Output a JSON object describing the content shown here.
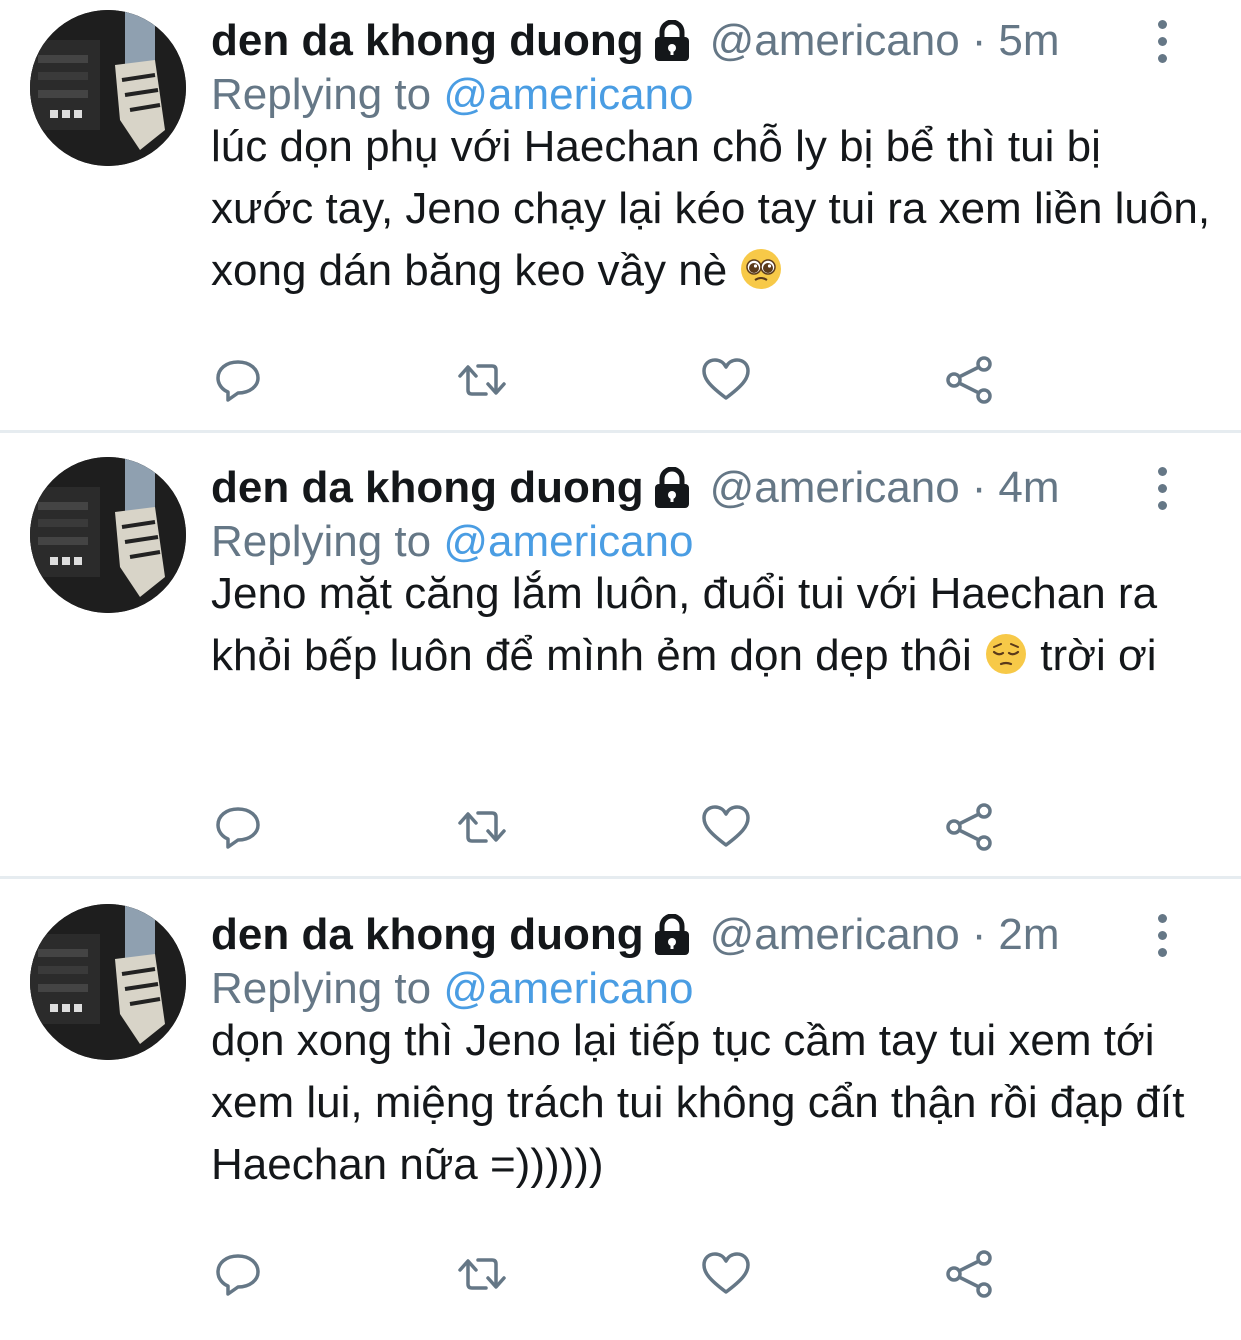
{
  "tweets": [
    {
      "name": "den da khong duong",
      "handle": "@americano",
      "separator": "·",
      "time": "5m",
      "replying_prefix": "Replying to",
      "replying_handle": "@americano",
      "text_before_emoji": "lúc dọn phụ với Haechan chỗ ly bị bể thì tui bị xước tay, Jeno chạy lại kéo tay tui ra xem liền luôn, xong dán băng keo vầy nè ",
      "emoji": "pleading-face",
      "text_after_emoji": ""
    },
    {
      "name": "den da khong duong",
      "handle": "@americano",
      "separator": "·",
      "time": "4m",
      "replying_prefix": "Replying to",
      "replying_handle": "@americano",
      "text_before_emoji": "Jeno mặt căng lắm luôn, đuổi tui với Haechan ra khỏi bếp luôn để mình ẻm dọn dẹp thôi ",
      "emoji": "pensive-face",
      "text_after_emoji": " trời ơi"
    },
    {
      "name": "den da khong duong",
      "handle": "@americano",
      "separator": "·",
      "time": "2m",
      "replying_prefix": "Replying to",
      "replying_handle": "@americano",
      "text_before_emoji": "dọn xong thì Jeno lại tiếp tục cầm tay tui xem tới xem lui, miệng trách tui không cẩn thận rồi đạp đít Haechan nữa =))))))",
      "emoji": "",
      "text_after_emoji": ""
    }
  ],
  "icons": {
    "lock": "lock-icon",
    "more": "more-vertical-icon",
    "reply": "reply-icon",
    "retweet": "retweet-icon",
    "like": "heart-icon",
    "share": "share-icon"
  },
  "colors": {
    "text": "#14171a",
    "secondary": "#657786",
    "link": "#4a9de3",
    "divider": "#e6ecf0"
  }
}
